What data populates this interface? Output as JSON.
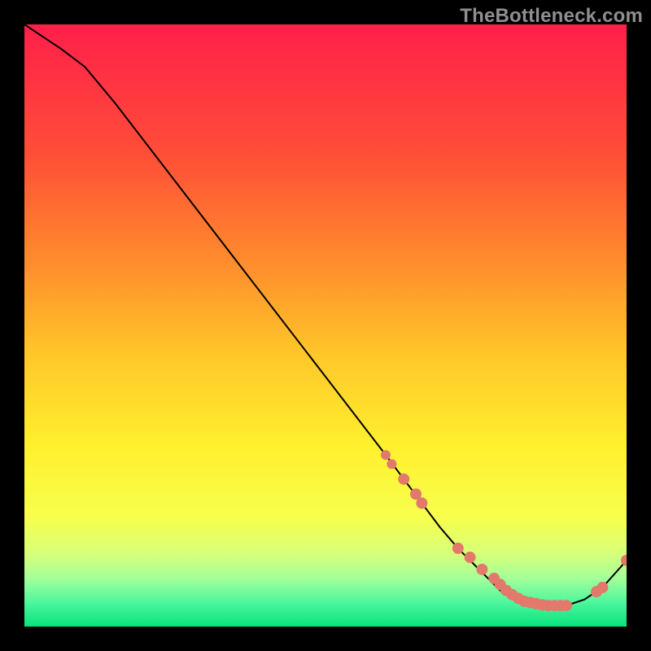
{
  "watermark": "TheBottleneck.com",
  "colors": {
    "bg_black": "#000000",
    "marker": "#e2796b",
    "curve": "#000000",
    "watermark_text": "#8f8f8f",
    "gradient_stops": [
      {
        "offset": 0.0,
        "color": "#ff1f4a"
      },
      {
        "offset": 0.22,
        "color": "#ff4f37"
      },
      {
        "offset": 0.4,
        "color": "#ff8e2c"
      },
      {
        "offset": 0.55,
        "color": "#ffc72a"
      },
      {
        "offset": 0.7,
        "color": "#fff02e"
      },
      {
        "offset": 0.82,
        "color": "#f7ff4d"
      },
      {
        "offset": 0.88,
        "color": "#d6ff7a"
      },
      {
        "offset": 0.92,
        "color": "#a4ff9a"
      },
      {
        "offset": 0.96,
        "color": "#4cf79d"
      },
      {
        "offset": 1.0,
        "color": "#08e27e"
      }
    ]
  },
  "chart_data": {
    "type": "line",
    "title": "",
    "xlabel": "",
    "ylabel": "",
    "xlim": [
      0,
      100
    ],
    "ylim": [
      0,
      100
    ],
    "series": [
      {
        "name": "bottleneck-curve",
        "x": [
          0,
          3,
          6,
          10,
          15,
          20,
          25,
          30,
          35,
          40,
          45,
          50,
          55,
          60,
          63,
          66,
          69,
          72,
          75,
          79,
          83,
          87,
          90,
          93,
          96,
          100
        ],
        "y": [
          100,
          98,
          96,
          93,
          87,
          80.5,
          74,
          67.5,
          61,
          54.5,
          48,
          41.5,
          35,
          28.5,
          24.5,
          20.5,
          16.5,
          13,
          10,
          6,
          4,
          3.5,
          3.5,
          4.5,
          6.5,
          11
        ]
      }
    ],
    "markers": {
      "name": "highlighted-points",
      "x": [
        60,
        61,
        63,
        65,
        66,
        72,
        74,
        76,
        78,
        79,
        80,
        81,
        82,
        83,
        84,
        85,
        86,
        87,
        88,
        89,
        90,
        95,
        96,
        100
      ],
      "y": [
        28.5,
        27,
        24.5,
        22,
        20.5,
        13,
        11.5,
        9.5,
        8,
        7,
        6,
        5.3,
        4.7,
        4.2,
        4,
        3.8,
        3.6,
        3.5,
        3.5,
        3.5,
        3.5,
        5.8,
        6.5,
        11
      ],
      "r": [
        6,
        6,
        7,
        7,
        7,
        7,
        7,
        7,
        7,
        7,
        7,
        7,
        7,
        7,
        7,
        7,
        7,
        7,
        7,
        7,
        7,
        7,
        7,
        7
      ]
    }
  }
}
